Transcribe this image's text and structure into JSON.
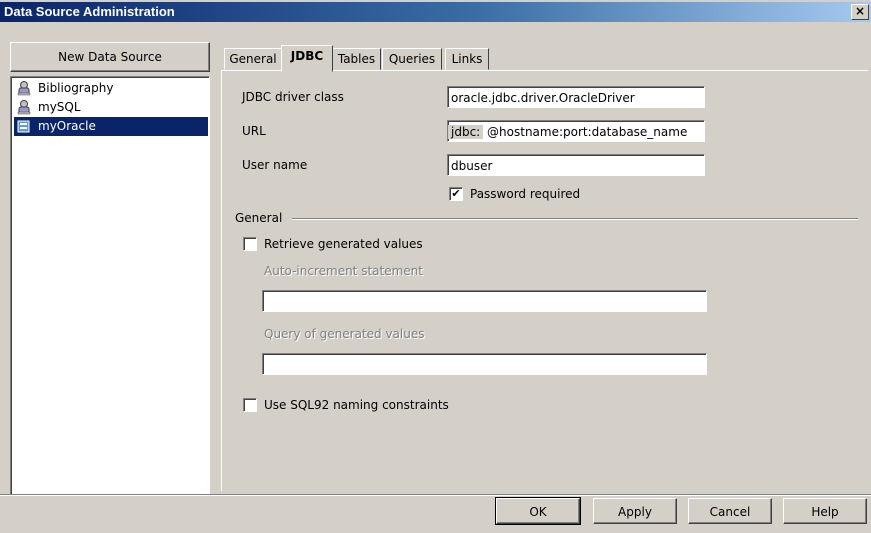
{
  "window": {
    "title": "Data Source Administration",
    "close_glyph": "×"
  },
  "left": {
    "new_button": "New Data Source",
    "sources": [
      {
        "label": "Bibliography",
        "icon": "database-user-icon",
        "selected": false
      },
      {
        "label": "mySQL",
        "icon": "database-user-icon",
        "selected": false
      },
      {
        "label": "myOracle",
        "icon": "database-db-icon",
        "selected": true
      }
    ]
  },
  "tabs": [
    {
      "label": "General",
      "active": false
    },
    {
      "label": "JDBC",
      "active": true
    },
    {
      "label": "Tables",
      "active": false
    },
    {
      "label": "Queries",
      "active": false
    },
    {
      "label": "Links",
      "active": false
    }
  ],
  "jdbc": {
    "driver_label": "JDBC driver class",
    "driver_value": "oracle.jdbc.driver.OracleDriver",
    "url_label": "URL",
    "url_prefix": "jdbc:",
    "url_value": "@hostname:port:database_name",
    "user_label": "User name",
    "user_value": "dbuser",
    "password_required_label": "Password required",
    "password_required_checked": true
  },
  "general": {
    "group_label": "General",
    "retrieve_label": "Retrieve generated values",
    "retrieve_checked": false,
    "autoinc_label": "Auto-increment statement",
    "autoinc_value": "",
    "query_label": "Query of generated values",
    "query_value": "",
    "sql92_label": "Use SQL92 naming constraints",
    "sql92_checked": false
  },
  "buttons": {
    "ok": "OK",
    "apply": "Apply",
    "cancel": "Cancel",
    "help": "Help"
  },
  "colors": {
    "title_start": "#0a246a",
    "title_end": "#a6caf0",
    "selection": "#0a246a",
    "face": "#d4d0c8"
  }
}
